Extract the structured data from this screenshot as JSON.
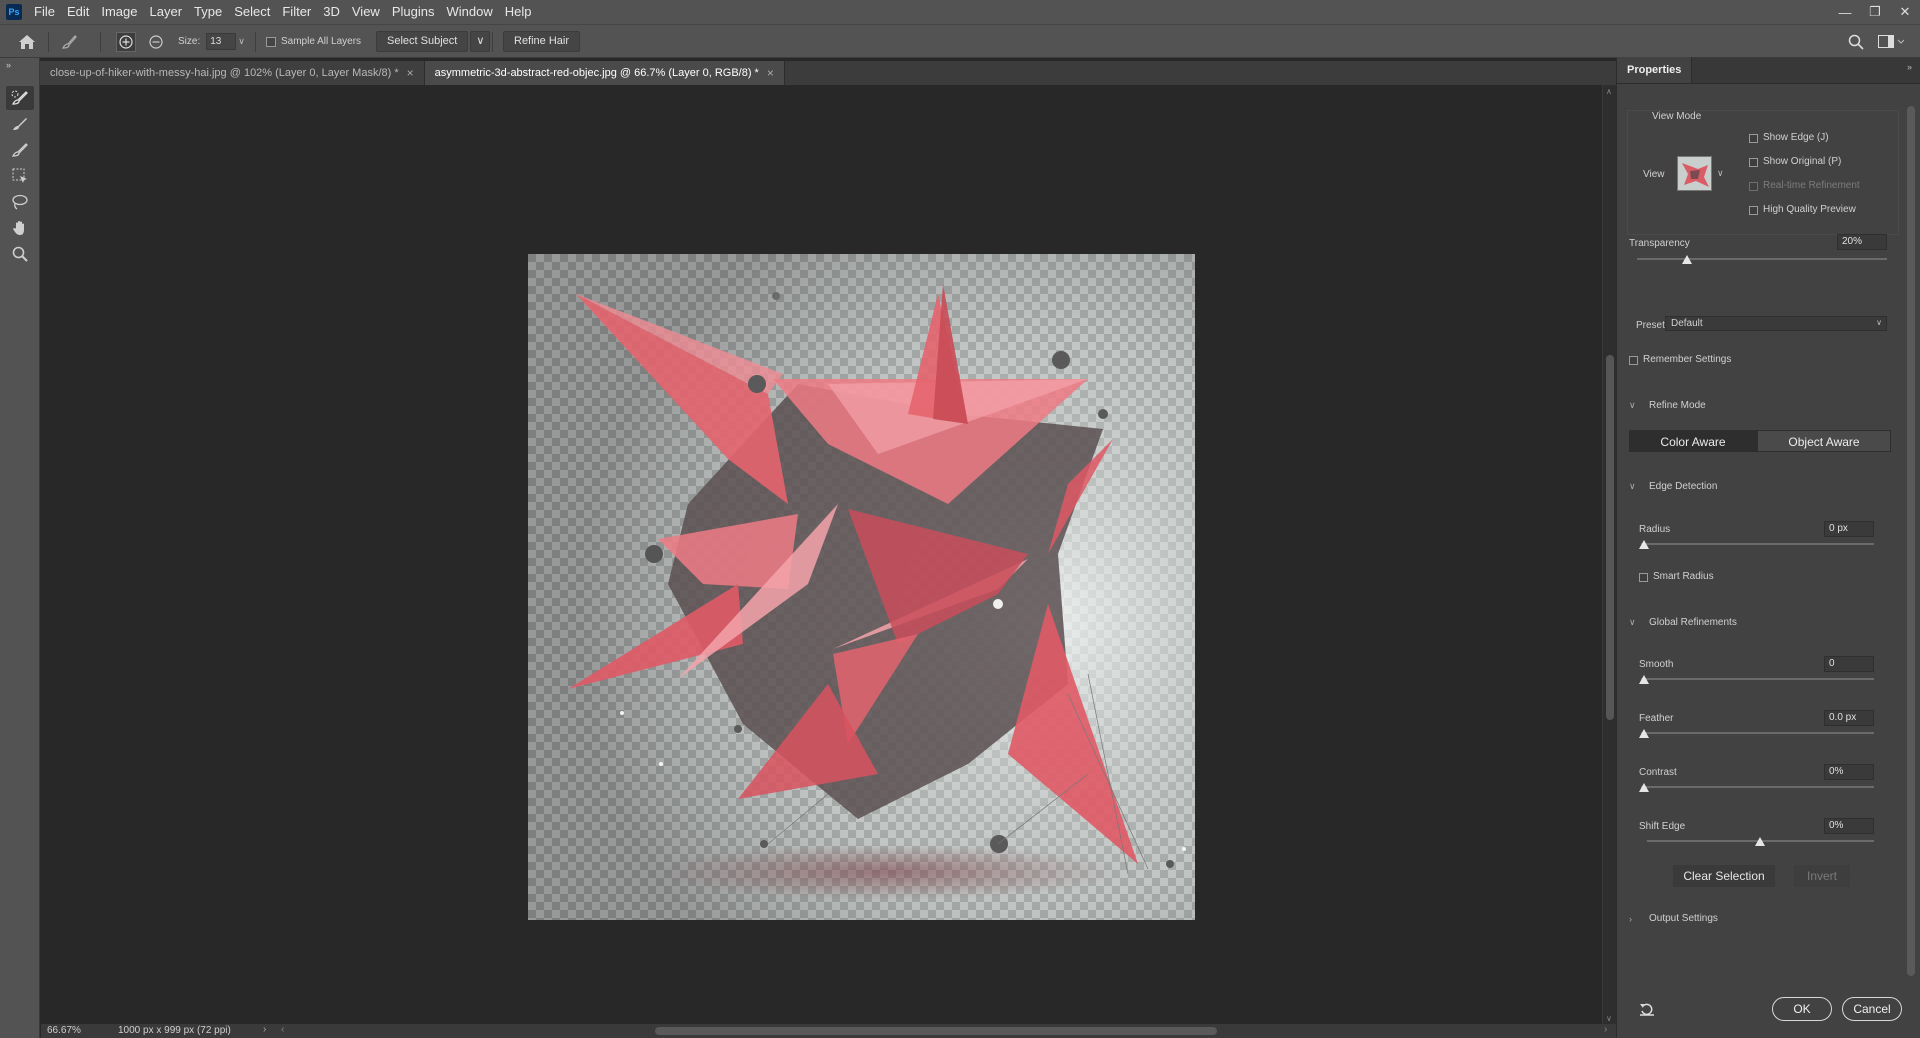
{
  "app": {
    "logo": "Ps",
    "menu": [
      "File",
      "Edit",
      "Image",
      "Layer",
      "Type",
      "Select",
      "Filter",
      "3D",
      "View",
      "Plugins",
      "Window",
      "Help"
    ]
  },
  "options": {
    "size_label": "Size:",
    "size_value": "13",
    "sample_all_layers": "Sample All Layers",
    "select_subject": "Select Subject",
    "refine_hair": "Refine Hair"
  },
  "tabs": [
    {
      "label": "close-up-of-hiker-with-messy-hai.jpg @ 102% (Layer 0, Layer Mask/8) *",
      "active": false
    },
    {
      "label": "asymmetric-3d-abstract-red-objec.jpg @ 66.7% (Layer 0, RGB/8) *",
      "active": true
    }
  ],
  "status": {
    "zoom": "66.67%",
    "doc_info": "1000 px x 999 px (72 ppi)"
  },
  "properties": {
    "tab": "Properties",
    "view_mode_title": "View Mode",
    "view_label": "View",
    "show_edge": "Show Edge (J)",
    "show_original": "Show Original (P)",
    "realtime_refinement": "Real-time Refinement",
    "high_quality_preview": "High Quality Preview",
    "transparency_label": "Transparency",
    "transparency_value": "20%",
    "transparency_level": 0.2,
    "preset_label": "Preset",
    "preset_value": "Default",
    "remember_settings": "Remember Settings",
    "refine_mode_title": "Refine Mode",
    "color_aware": "Color Aware",
    "object_aware": "Object Aware",
    "edge_detection_title": "Edge Detection",
    "radius_label": "Radius",
    "radius_value": "0 px",
    "smart_radius": "Smart Radius",
    "global_refinements_title": "Global Refinements",
    "smooth_label": "Smooth",
    "smooth_value": "0",
    "feather_label": "Feather",
    "feather_value": "0.0 px",
    "contrast_label": "Contrast",
    "contrast_value": "0%",
    "shift_edge_label": "Shift Edge",
    "shift_edge_value": "0%",
    "clear_selection": "Clear Selection",
    "invert": "Invert",
    "output_settings_title": "Output Settings",
    "ok": "OK",
    "cancel": "Cancel"
  },
  "colors": {
    "ui_bg": "#535353",
    "canvas_bg": "#282828",
    "panel_bg": "#424242",
    "object_red": "#e4646e",
    "accent_blue": "#31a8ff"
  },
  "icons": [
    "home-icon",
    "brush-tool-icon",
    "add-mode-icon",
    "subtract-mode-icon",
    "search-icon",
    "workspace-icon",
    "reset-icon"
  ]
}
